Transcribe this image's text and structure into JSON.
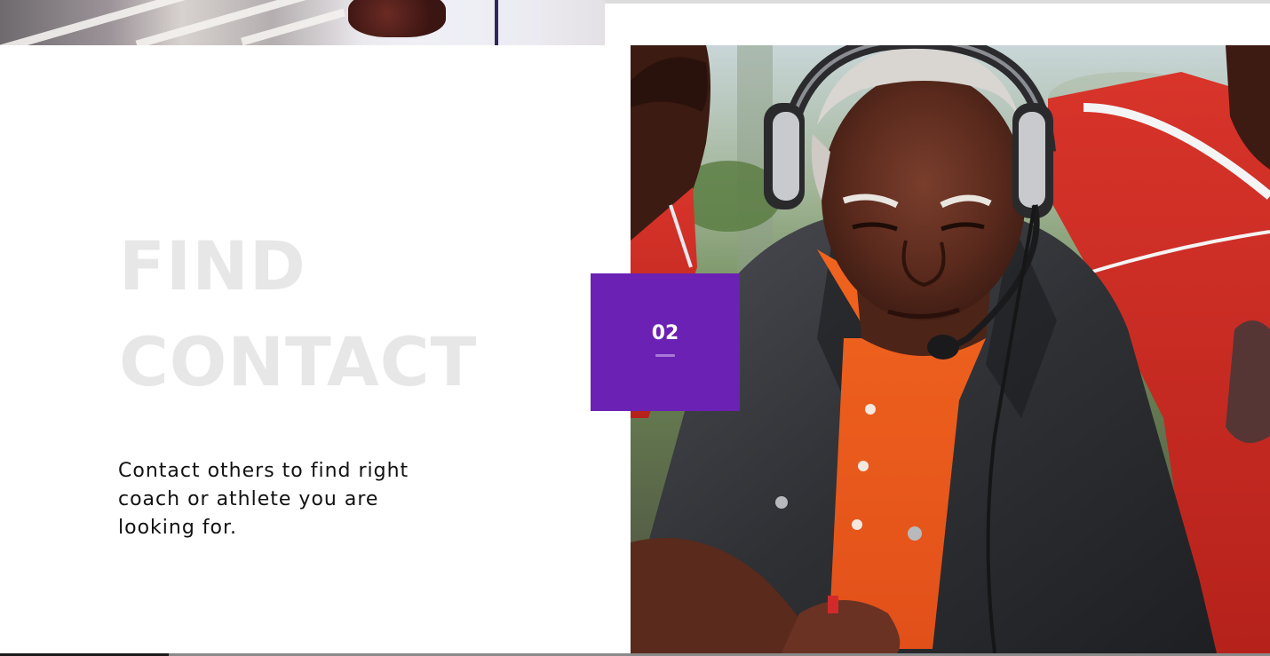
{
  "section": {
    "step_number": "02",
    "heading_line1": "FIND",
    "heading_line2": "CONTACT",
    "description": "Contact others to find right coach or athlete you are looking for."
  },
  "colors": {
    "accent": "#6b21b4",
    "heading": "#e7e7e7",
    "body_text": "#111111",
    "background": "#ffffff"
  }
}
